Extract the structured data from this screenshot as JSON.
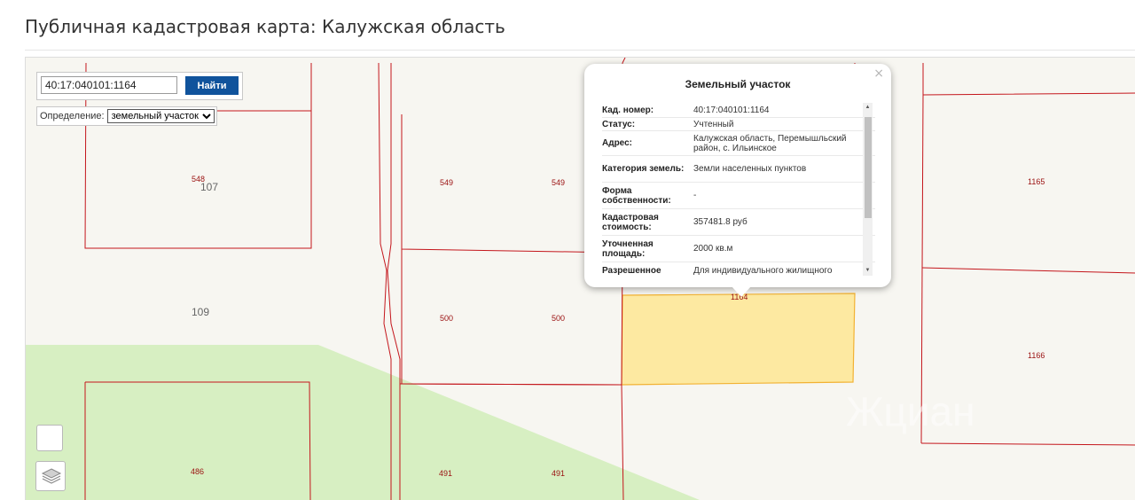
{
  "header": {
    "title": "Публичная кадастровая карта: Калужская область"
  },
  "search": {
    "value": "40:17:040101:1164",
    "button_label": "Найти"
  },
  "definition": {
    "label": "Определение:",
    "selected": "земельный участок"
  },
  "map": {
    "plot_labels": [
      "548",
      "549",
      "549",
      "500",
      "500",
      "486",
      "491",
      "491",
      "1164",
      "1165",
      "1166"
    ],
    "quarter_labels": [
      "107",
      "109"
    ],
    "watermark": "Жциан",
    "colors": {
      "parcel_border": "#c4161c",
      "selected_fill": "#fde9a1",
      "selected_border": "#f2b233",
      "green": "#d7efc2"
    }
  },
  "popup": {
    "close": "×",
    "title": "Земельный участок",
    "rows": [
      {
        "key": "Кад. номер:",
        "value": "40:17:040101:1164"
      },
      {
        "key": "Статус:",
        "value": "Учтенный"
      },
      {
        "key": "Адрес:",
        "value": "Калужская область, Перемышльский район, с. Ильинское"
      },
      {
        "key": "Категория земель:",
        "value": "Земли населенных пунктов"
      },
      {
        "key": "Форма собственности:",
        "value": "-"
      },
      {
        "key": "Кадастровая стоимость:",
        "value": "357481.8 руб"
      },
      {
        "key": "Уточненная площадь:",
        "value": "2000 кв.м"
      },
      {
        "key": "Разрешенное",
        "value": "Для индивидуального жилищного"
      }
    ]
  },
  "controls": {
    "layers_icon": "layers-icon"
  }
}
